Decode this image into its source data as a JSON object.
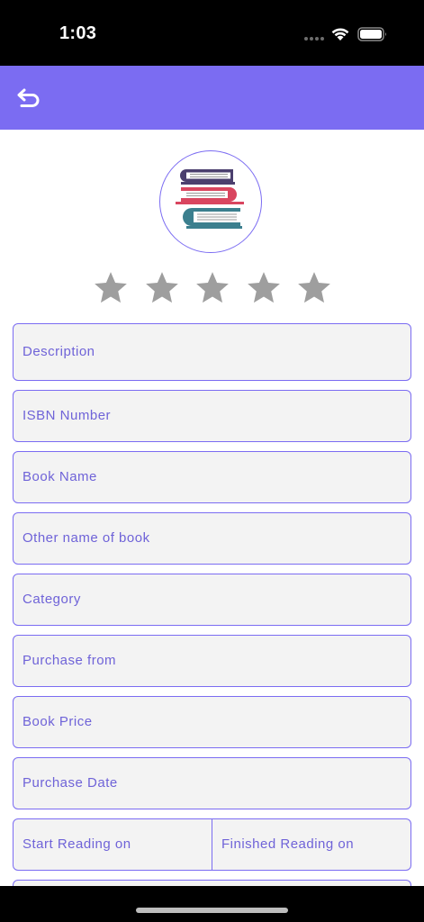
{
  "status_bar": {
    "time": "1:03"
  },
  "app_bar": {
    "back_icon": "back-arrow-icon",
    "background": "#7b6cf2"
  },
  "book_image": {
    "icon": "stacked-books-icon"
  },
  "rating": {
    "stars": 5,
    "value": 0,
    "empty_color": "#9e9e9e"
  },
  "form": {
    "description": "Description",
    "isbn": "ISBN Number",
    "book_name": "Book Name",
    "other_name": "Other name of book",
    "category": "Category",
    "purchase_from": "Purchase from",
    "book_price": "Book Price",
    "purchase_date": "Purchase Date",
    "start_reading": "Start Reading on",
    "finished_reading": "Finished Reading on"
  },
  "colors": {
    "accent": "#7b6cf2",
    "label": "#6f63d8",
    "field_bg": "#f3f3f3"
  }
}
